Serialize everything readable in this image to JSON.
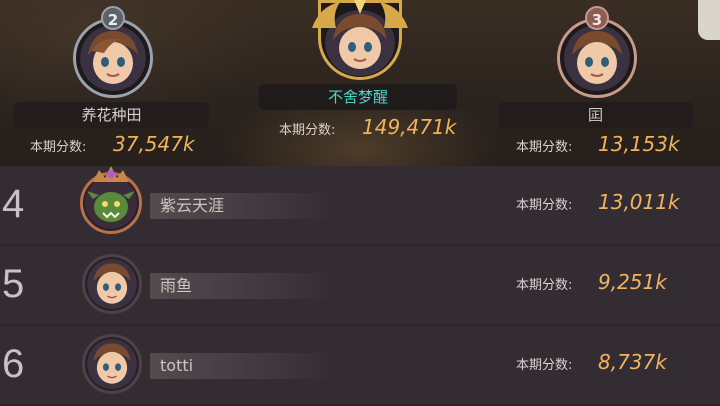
{
  "score_label": "本期分数:",
  "podium": [
    {
      "rank": "2",
      "name": "养花种田",
      "score": "37,547k"
    },
    {
      "rank": "1",
      "name": "不舍梦醒",
      "score": "149,471k"
    },
    {
      "rank": "3",
      "name": "囸",
      "score": "13,153k"
    }
  ],
  "rows": [
    {
      "rank": "4",
      "name": "紫云天涯",
      "score": "13,011k"
    },
    {
      "rank": "5",
      "name": "雨鱼",
      "score": "9,251k"
    },
    {
      "rank": "6",
      "name": "totti",
      "score": "8,737k"
    }
  ],
  "colors": {
    "score": "#f1b35b",
    "champion_name": "#4fd3c4",
    "gold": "#d8a94a"
  },
  "icons": {
    "menu_corner": "menu-icon"
  }
}
